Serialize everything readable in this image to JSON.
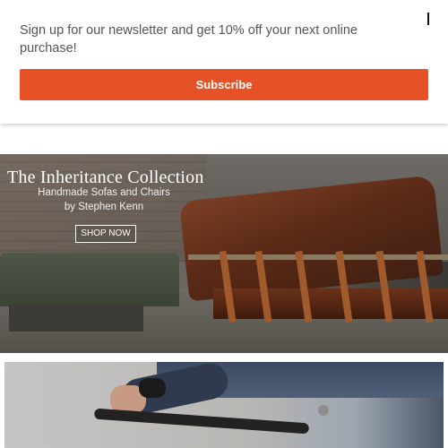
{
  "newsletter": {
    "message": "Sign up for our newsletter and get 10% off your next online purchase!",
    "subscribe_label": "Subscribe",
    "close_icon": "close-icon"
  },
  "hero": {
    "title": "The Inheritance Collection",
    "subtitle_line1": "Handmade Sofas and Chairs",
    "subtitle_line2": "by Stephen Kenn",
    "cta_label": "SHOP NOW"
  },
  "colors": {
    "accent": "#e75126",
    "text": "#555555"
  }
}
